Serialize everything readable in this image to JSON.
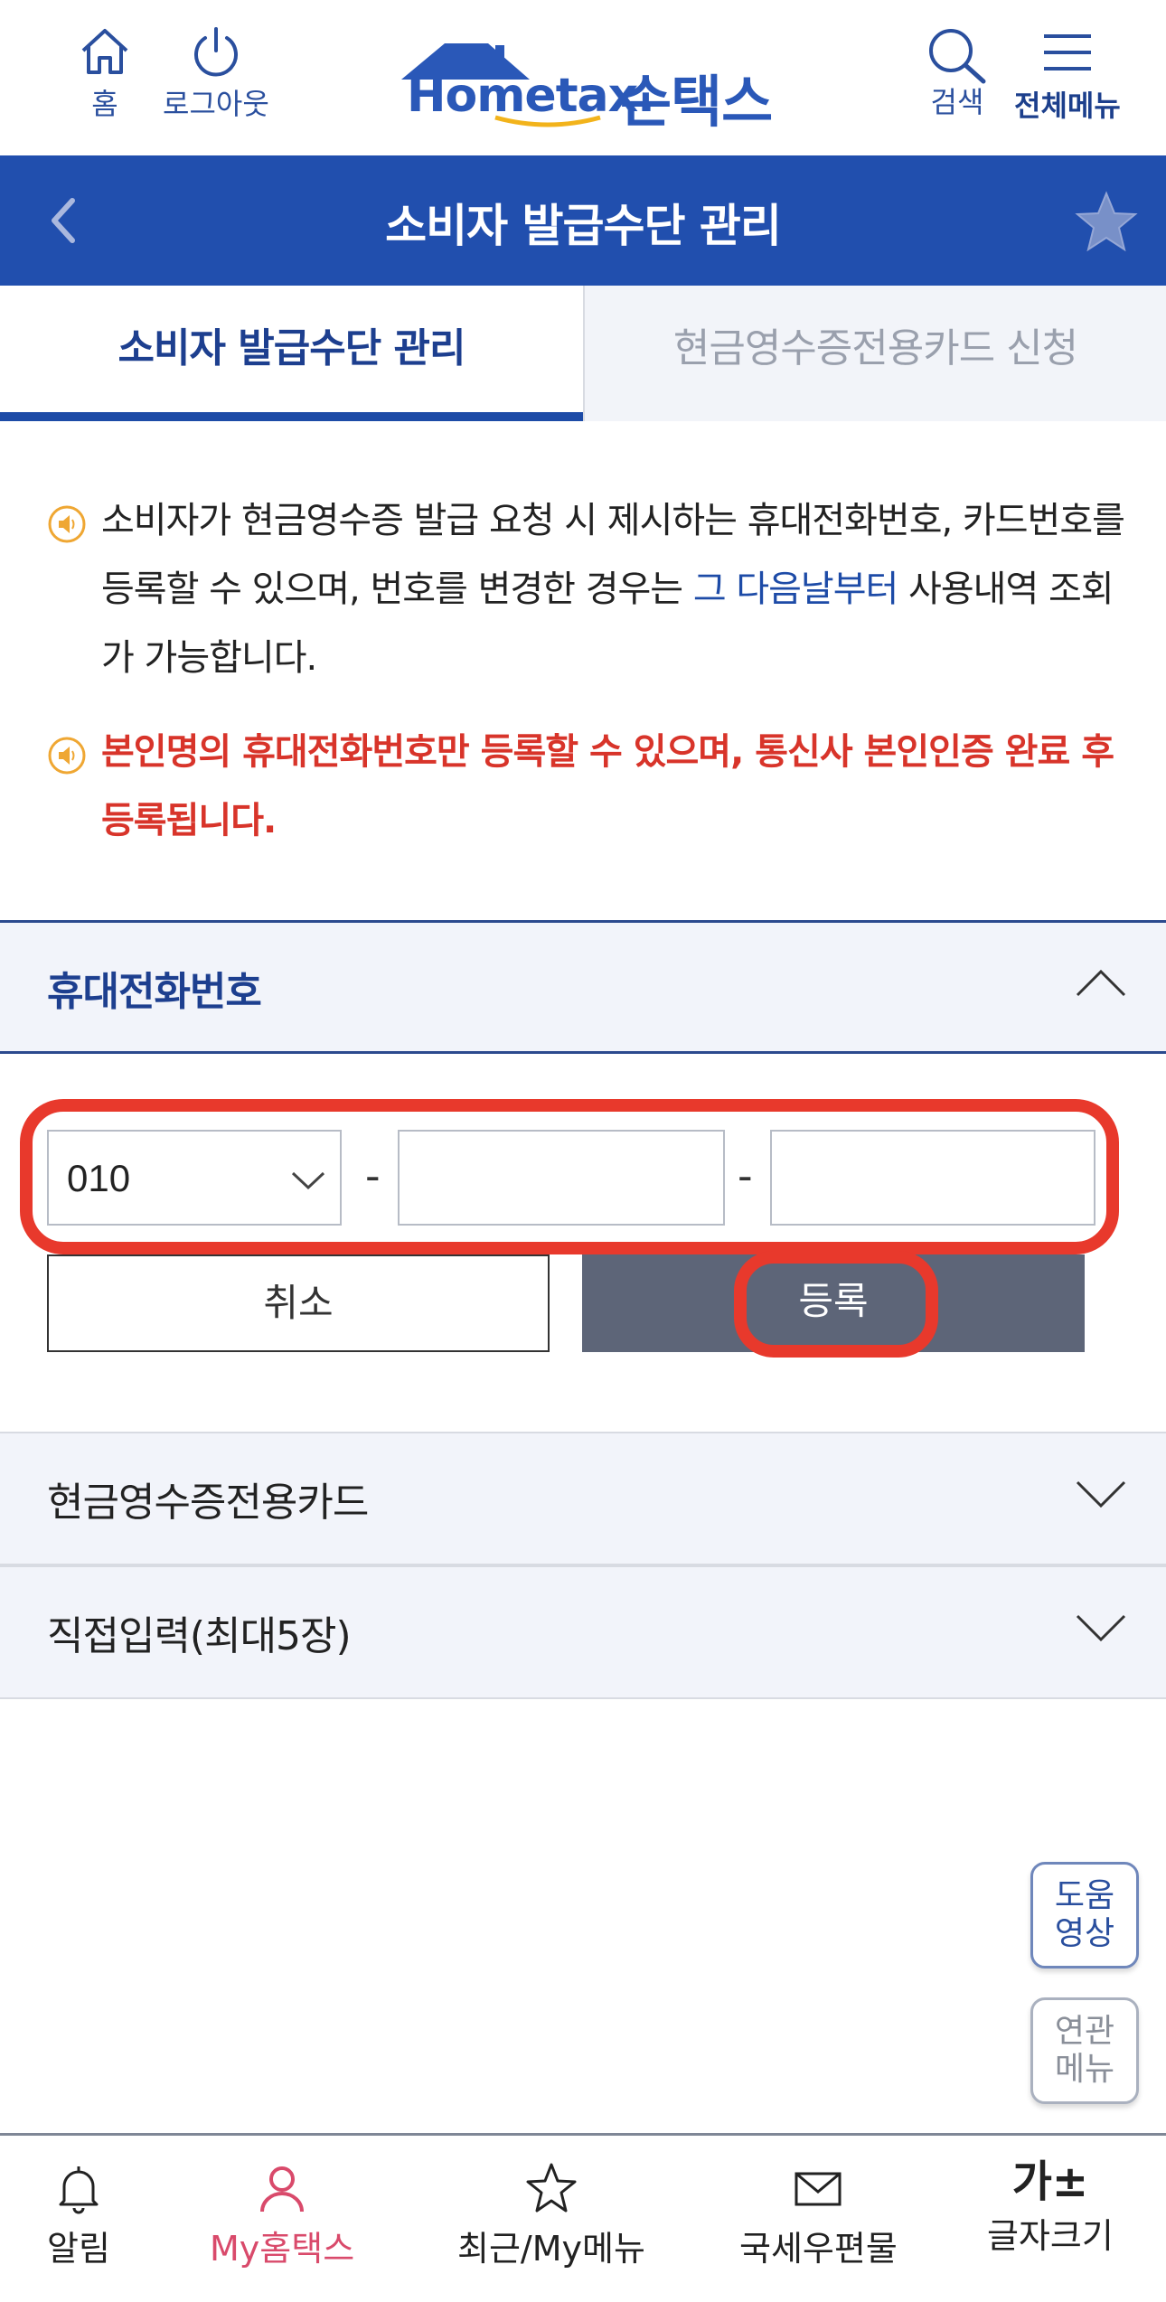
{
  "header": {
    "home_label": "홈",
    "logout_label": "로그아웃",
    "logo_en": "Hometax.",
    "logo_ko": "손택스",
    "search_label": "검색",
    "menu_label": "전체메뉴"
  },
  "titlebar": {
    "title": "소비자 발급수단 관리"
  },
  "tabs": [
    {
      "label": "소비자 발급수단 관리",
      "active": true
    },
    {
      "label": "현금영수증전용카드 신청",
      "active": false
    }
  ],
  "notices": {
    "n1_a": "소비자가 현금영수증 발급 요청 시 제시하는 휴대전화번호, 카드번호를 등록할 수 있으며, 번호를 변경한 경우는 ",
    "n1_highlight": "그 다음날부터",
    "n1_b": " 사용내역 조회가 가능합니다.",
    "n2": "본인명의 휴대전화번호만 등록할 수 있으며, 통신사 본인인증 완료 후 등록됩니다."
  },
  "phone_section": {
    "title": "휴대전화번호",
    "prefix_value": "010",
    "dash": "-",
    "middle_value": "",
    "last_value": "",
    "cancel_label": "취소",
    "register_label": "등록"
  },
  "sections": [
    {
      "title": "현금영수증전용카드"
    },
    {
      "title": "직접입력(최대5장)"
    }
  ],
  "floating": {
    "help_line1": "도움",
    "help_line2": "영상",
    "related_line1": "연관",
    "related_line2": "메뉴"
  },
  "bottom_nav": {
    "alarm": "알림",
    "my_hometax": "My홈택스",
    "recent": "최근/My메뉴",
    "mail": "국세우편물",
    "font_glyph": "가±",
    "font_size": "글자크기"
  },
  "colors": {
    "brand_blue": "#214fae",
    "highlight_red": "#e8392c",
    "notice_red": "#d8342a",
    "active_pink": "#d94a6b"
  }
}
